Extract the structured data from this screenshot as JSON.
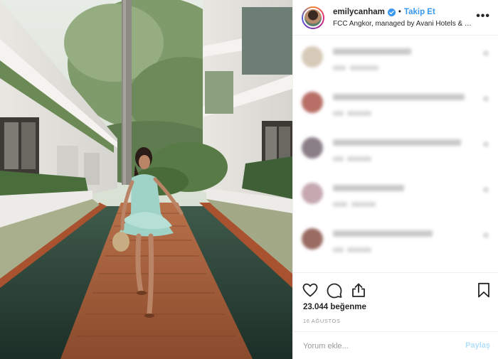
{
  "post": {
    "image_alt": "Woman in a light blue dress walking on a wooden deck between reflecting pools of a hotel courtyard",
    "header": {
      "username": "emilycanham",
      "verified": true,
      "separator": "•",
      "follow_label": "Takip Et",
      "location": "FCC Angkor, managed by Avani Hotels & Res...",
      "more_icon": "more-options-icon"
    },
    "comments_note": "comments are blurred in the screenshot",
    "actions": {
      "like_icon": "heart-icon",
      "comment_icon": "comment-icon",
      "share_icon": "share-icon",
      "save_icon": "bookmark-icon"
    },
    "likes_text": "23.044 beğenme",
    "date_text": "16 AĞUSTOS",
    "comment_box": {
      "placeholder": "Yorum ekle...",
      "post_label": "Paylaş"
    }
  },
  "colors": {
    "accent": "#3897f0",
    "post_disabled": "#b2dffc",
    "divider": "#efefef",
    "muted_text": "#999999"
  }
}
